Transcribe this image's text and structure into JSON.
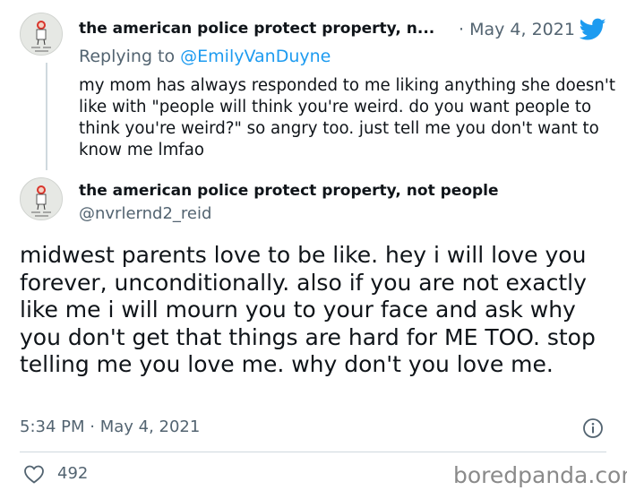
{
  "reply_tweet": {
    "display_name": "the american police protect property, n...",
    "date": "· May 4, 2021",
    "replying_to_prefix": "Replying to",
    "replying_to_handle": "@EmilyVanDuyne",
    "body": "my mom has always responded to me liking anything she doesn't like with \"people will think you're weird. do you want people to think you're weird?\" so angry too. just tell me you don't want to know me lmfao"
  },
  "main_tweet": {
    "display_name": "the american police protect property, not people",
    "handle": "@nvrlernd2_reid",
    "body": "midwest parents love to be like. hey i will love you forever, unconditionally. also if you are not exactly like me i will mourn you to your face and ask why you don't get that things are hard for ME TOO. stop telling me you love me. why don't you love me.",
    "timestamp": "5:34 PM · May 4, 2021",
    "likes": "492"
  },
  "watermark": "boredpanda.com",
  "icons": {
    "brand": "twitter-bird-icon",
    "info": "info-icon",
    "like": "heart-icon"
  },
  "colors": {
    "text": "#0f1419",
    "secondary": "#536471",
    "link": "#1d9bf0",
    "divider": "#cfd9de"
  }
}
